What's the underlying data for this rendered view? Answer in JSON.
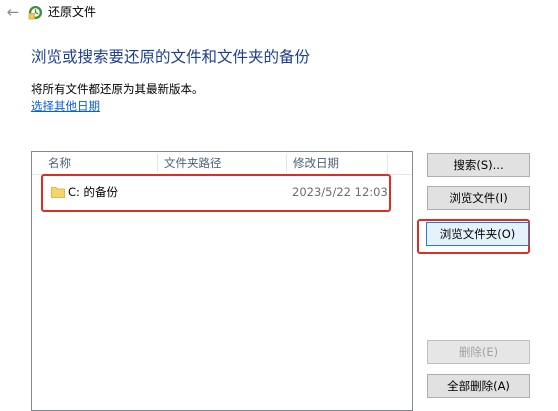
{
  "window": {
    "title": "还原文件",
    "back_icon": "back-arrow-icon",
    "app_icon": "restore-files-icon"
  },
  "main": {
    "heading": "浏览或搜索要还原的文件和文件夹的备份",
    "description": "将所有文件都还原为其最新版本。",
    "other_date_link": "选择其他日期"
  },
  "list": {
    "columns": [
      "名称",
      "文件夹路径",
      "修改日期"
    ],
    "rows": [
      {
        "icon": "folder-icon",
        "name": "C: 的备份",
        "path": "",
        "modified": "2023/5/22 12:03"
      }
    ]
  },
  "buttons": {
    "search": "搜索(S)...",
    "browse_files": "浏览文件(I)",
    "browse_folders": "浏览文件夹(O)",
    "remove": "删除(E)",
    "remove_all": "全部删除(A)"
  },
  "colors": {
    "heading": "#1c3f94",
    "link": "#0b5ed7",
    "highlight": "#d93025",
    "button_face": "#e1e1e1",
    "button_focus": "#2b7ad6"
  }
}
